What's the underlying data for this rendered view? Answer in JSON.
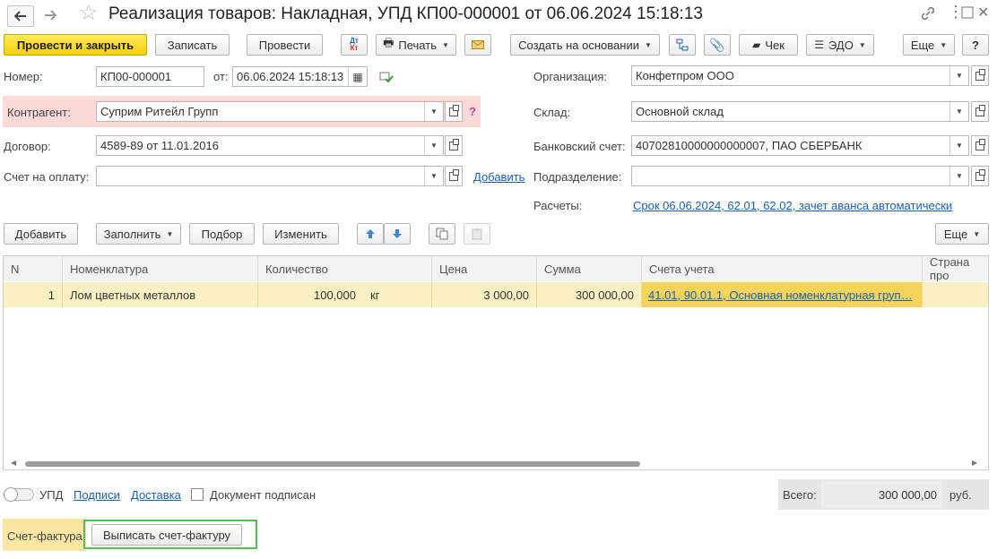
{
  "window": {
    "title": "Реализация товаров: Накладная, УПД КП00-000001 от 06.06.2024 15:18:13"
  },
  "toolbar": {
    "post_close": "Провести и закрыть",
    "save": "Записать",
    "post": "Провести",
    "dt_kt": "Дт Кт",
    "print": "Печать",
    "create_based": "Создать на основании",
    "check": "Чек",
    "edo": "ЭДО",
    "more": "Еще",
    "help": "?"
  },
  "form": {
    "number_label": "Номер:",
    "number_value": "КП00-000001",
    "date_label": "от:",
    "date_value": "06.06.2024 15:18:13",
    "contractor_label": "Контрагент:",
    "contractor_value": "Суприм Ритейл Групп",
    "contractor_hint": "?",
    "contract_label": "Договор:",
    "contract_value": "4589-89 от 11.01.2016",
    "invoice_label": "Счет на оплату:",
    "invoice_value": "",
    "invoice_add": "Добавить",
    "org_label": "Организация:",
    "org_value": "Конфетпром ООО",
    "warehouse_label": "Склад:",
    "warehouse_value": "Основной склад",
    "bank_label": "Банковский счет:",
    "bank_value": "40702810000000000007, ПАО СБЕРБАНК",
    "division_label": "Подразделение:",
    "division_value": "",
    "settlements_label": "Расчеты:",
    "settlements_value": "Срок 06.06.2024, 62.01, 62.02, зачет аванса автоматически"
  },
  "table_toolbar": {
    "add": "Добавить",
    "fill": "Заполнить",
    "selection": "Подбор",
    "change": "Изменить",
    "more": "Еще"
  },
  "table": {
    "headers": [
      "N",
      "Номенклатура",
      "Количество",
      "Цена",
      "Сумма",
      "Счета учета",
      "Страна про"
    ],
    "rows": [
      {
        "n": "1",
        "item": "Лом цветных металлов",
        "qty": "100,000",
        "unit": "кг",
        "price": "3 000,00",
        "sum": "300 000,00",
        "accounts": "41.01, 90.01.1, Основная номенклатурная груп…",
        "country": ""
      }
    ]
  },
  "footer": {
    "upd": "УПД",
    "signatures": "Подписи",
    "delivery": "Доставка",
    "signed": "Документ подписан",
    "total_label": "Всего:",
    "total_value": "300 000,00",
    "currency": "руб.",
    "invoice_label": "Счет-фактура:",
    "invoice_button": "Выписать счет-фактуру"
  },
  "colors": {
    "accent_yellow": "#f6d000",
    "link": "#1f5fa8",
    "highlight_green": "#5cb85c",
    "row_selected": "#fbf0c4",
    "contractor_bg": "#fbd9d9"
  }
}
